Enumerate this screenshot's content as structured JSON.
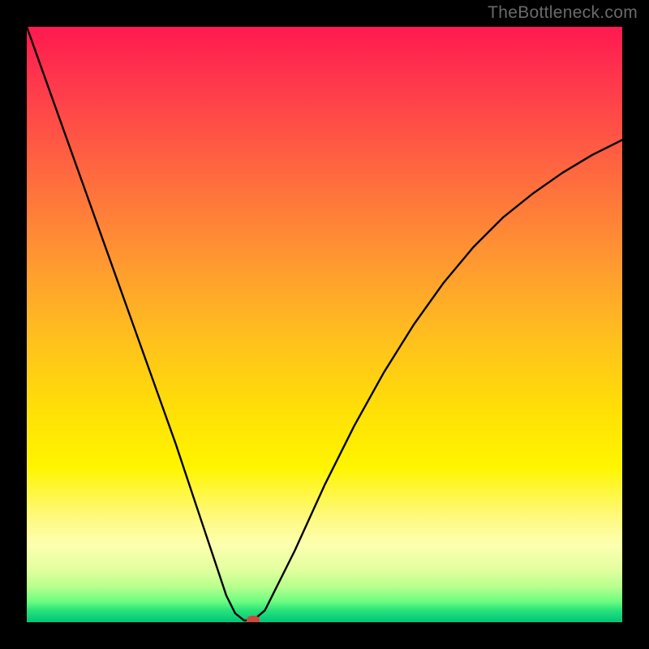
{
  "watermark": "TheBottleneck.com",
  "chart_data": {
    "type": "line",
    "title": "",
    "xlabel": "",
    "ylabel": "",
    "xlim": [
      0,
      100
    ],
    "ylim": [
      0,
      100
    ],
    "grid": false,
    "series": [
      {
        "name": "curve",
        "x": [
          0,
          5,
          10,
          15,
          20,
          25,
          28,
          30,
          32,
          33.5,
          35,
          36.5,
          38,
          40,
          45,
          50,
          55,
          60,
          65,
          70,
          75,
          80,
          85,
          90,
          95,
          100
        ],
        "values": [
          100,
          86,
          72,
          58,
          44,
          30,
          21,
          15,
          9,
          4.5,
          1.5,
          0.3,
          0.3,
          2,
          12,
          23,
          33,
          42,
          50,
          57,
          63,
          68,
          72,
          75.5,
          78.5,
          81
        ]
      }
    ],
    "plateau": {
      "x_start": 33.5,
      "x_end": 38,
      "y": 0.3
    },
    "marker": {
      "x": 38,
      "y": 0.3,
      "color": "#cb4a3b"
    },
    "gradient_stops": [
      {
        "pct": 0,
        "color": "#ff1950"
      },
      {
        "pct": 25,
        "color": "#ff6a3f"
      },
      {
        "pct": 52,
        "color": "#ffbf1e"
      },
      {
        "pct": 74,
        "color": "#fff500"
      },
      {
        "pct": 91,
        "color": "#e3ff9e"
      },
      {
        "pct": 100,
        "color": "#00c47a"
      }
    ]
  }
}
